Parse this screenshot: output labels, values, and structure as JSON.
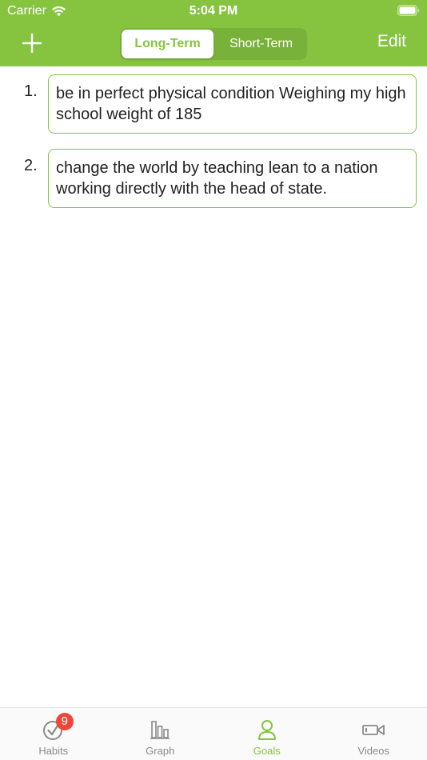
{
  "status_bar": {
    "carrier": "Carrier",
    "time": "5:04 PM"
  },
  "nav": {
    "add_icon": "plus-icon",
    "segments": [
      "Long-Term",
      "Short-Term"
    ],
    "selected_segment": "Long-Term",
    "edit_label": "Edit"
  },
  "goals": [
    {
      "number": "1.",
      "text": "be in perfect physical condition Weighing my high school weight of 185"
    },
    {
      "number": "2.",
      "text": "change the world by teaching lean to a nation working directly with the head of state."
    }
  ],
  "tabs": [
    {
      "label": "Habits",
      "icon": "check-circle-icon",
      "badge": "9"
    },
    {
      "label": "Graph",
      "icon": "bar-graph-icon"
    },
    {
      "label": "Goals",
      "icon": "person-icon"
    },
    {
      "label": "Videos",
      "icon": "video-camera-icon"
    }
  ],
  "active_tab": "Goals",
  "colors": {
    "accent": "#86c440",
    "badge": "#f0463a",
    "inactive": "#8a8a8a"
  }
}
